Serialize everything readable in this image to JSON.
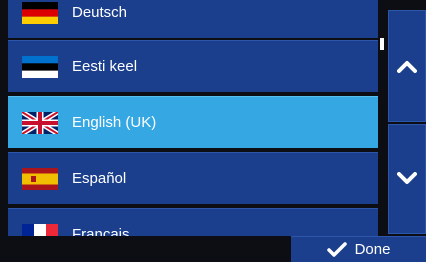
{
  "languages": [
    {
      "label": "Deutsch",
      "flag": "germany-flag",
      "selected": false
    },
    {
      "label": "Eesti keel",
      "flag": "estonia-flag",
      "selected": false
    },
    {
      "label": "English (UK)",
      "flag": "uk-flag",
      "selected": true
    },
    {
      "label": "Español",
      "flag": "spain-flag",
      "selected": false
    },
    {
      "label": "Français",
      "flag": "france-flag",
      "selected": false
    }
  ],
  "controls": {
    "scroll_up_icon": "chevron-up-icon",
    "scroll_down_icon": "chevron-down-icon",
    "done_label": "Done",
    "done_icon": "checkmark-icon"
  },
  "colors": {
    "row_background": "#1b3f8c",
    "selected_background": "#35a8e3",
    "page_background": "#0d0d14"
  }
}
